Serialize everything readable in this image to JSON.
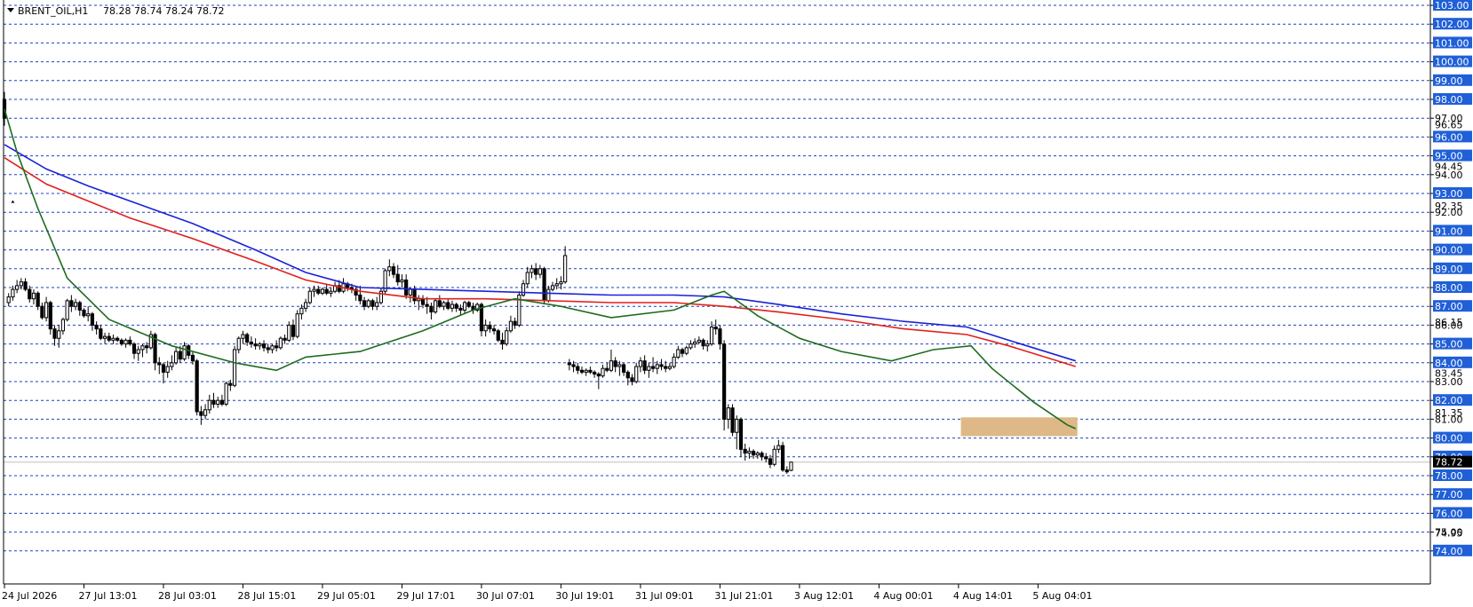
{
  "header": {
    "symbol": "BRENT_OIL,H1",
    "ohlc": "78.28 78.74 78.24 78.72"
  },
  "colors": {
    "grid": "#1f3fbf",
    "price_label_bg": "#1f5fd8",
    "ma_fast": "#1e6b1e",
    "ma_mid": "#e0201a",
    "ma_slow": "#1a22d8",
    "zone": "#deb887",
    "current_price_line": "#c0c0c0"
  },
  "chart_data": {
    "type": "candlestick",
    "ylim": [
      74,
      103
    ],
    "y_ticks": [
      "103.00",
      "102.00",
      "101.00",
      "100.00",
      "99.00",
      "98.00",
      "97.00",
      "96.00",
      "95.00",
      "94.00",
      "93.00",
      "92.00",
      "91.00",
      "90.00",
      "89.00",
      "88.00",
      "87.00",
      "86.00",
      "85.00",
      "84.00",
      "83.00",
      "82.00",
      "81.00",
      "80.00",
      "79.00",
      "78.00",
      "77.00",
      "76.00",
      "75.00",
      "74.00"
    ],
    "y_extra_labels": [
      {
        "value": 96.65,
        "text": "96.65"
      },
      {
        "value": 94.45,
        "text": "94.45"
      },
      {
        "value": 92.35,
        "text": "92.35"
      },
      {
        "value": 86.15,
        "text": "86.15"
      },
      {
        "value": 83.45,
        "text": "83.45"
      },
      {
        "value": 81.35,
        "text": "81.35"
      },
      {
        "value": 74.95,
        "text": "74.95"
      }
    ],
    "current_price": {
      "value": 78.72,
      "text": "78.72"
    },
    "x_labels": [
      "24 Jul 2026",
      "27 Jul 13:01",
      "28 Jul 03:01",
      "28 Jul 15:01",
      "29 Jul 05:01",
      "29 Jul 17:01",
      "30 Jul 07:01",
      "30 Jul 19:01",
      "31 Jul 09:01",
      "31 Jul 21:01",
      "3 Aug 12:01",
      "4 Aug 00:01",
      "4 Aug 14:01",
      "5 Aug 04:01"
    ],
    "x_label_index": [
      0,
      19,
      38,
      57,
      76,
      95,
      114,
      133,
      152,
      171,
      190,
      209,
      228,
      247
    ],
    "zone": {
      "from_index": 229,
      "to_index": 256,
      "low": 80.1,
      "high": 81.1
    },
    "candles": [
      [
        98.0,
        98.4,
        96.6,
        97.0
      ],
      [
        87.2,
        87.7,
        87.0,
        87.5
      ],
      [
        87.5,
        88.1,
        87.3,
        87.9
      ],
      [
        87.9,
        88.4,
        87.7,
        88.1
      ],
      [
        88.1,
        88.5,
        87.9,
        88.3
      ],
      [
        88.3,
        88.5,
        87.8,
        87.9
      ],
      [
        87.9,
        88.1,
        87.2,
        87.4
      ],
      [
        87.4,
        87.9,
        87.1,
        87.7
      ],
      [
        87.7,
        87.8,
        86.8,
        87.0
      ],
      [
        87.0,
        87.2,
        86.3,
        86.4
      ],
      [
        86.4,
        87.5,
        86.2,
        87.2
      ],
      [
        87.2,
        87.3,
        85.5,
        85.8
      ],
      [
        85.8,
        86.0,
        84.9,
        85.3
      ],
      [
        85.3,
        86.0,
        84.8,
        85.7
      ],
      [
        85.7,
        86.4,
        85.5,
        86.3
      ],
      [
        86.3,
        87.4,
        86.2,
        87.3
      ],
      [
        87.3,
        87.6,
        86.7,
        87.0
      ],
      [
        87.0,
        87.4,
        86.8,
        87.2
      ],
      [
        87.2,
        87.3,
        86.5,
        86.8
      ],
      [
        86.8,
        86.9,
        86.4,
        86.5
      ],
      [
        86.5,
        87.0,
        86.2,
        86.6
      ],
      [
        86.6,
        86.7,
        85.7,
        86.0
      ],
      [
        86.0,
        86.2,
        85.5,
        85.8
      ],
      [
        85.8,
        86.0,
        85.2,
        85.3
      ],
      [
        85.3,
        85.6,
        85.0,
        85.4
      ],
      [
        85.4,
        85.6,
        85.1,
        85.2
      ],
      [
        85.2,
        85.5,
        85.0,
        85.3
      ],
      [
        85.3,
        85.4,
        85.1,
        85.2
      ],
      [
        85.2,
        85.3,
        84.9,
        85.0
      ],
      [
        85.0,
        85.3,
        84.8,
        85.2
      ],
      [
        85.2,
        85.4,
        84.9,
        85.0
      ],
      [
        85.0,
        85.1,
        84.2,
        84.5
      ],
      [
        84.5,
        84.9,
        84.1,
        84.7
      ],
      [
        84.7,
        85.0,
        84.3,
        84.9
      ],
      [
        84.9,
        85.1,
        84.5,
        84.8
      ],
      [
        84.8,
        85.7,
        84.7,
        85.5
      ],
      [
        85.5,
        85.6,
        83.6,
        84.0
      ],
      [
        84.0,
        84.3,
        83.4,
        83.9
      ],
      [
        83.9,
        84.0,
        82.9,
        83.5
      ],
      [
        83.5,
        84.1,
        83.2,
        83.8
      ],
      [
        83.8,
        84.4,
        83.6,
        84.0
      ],
      [
        84.0,
        84.8,
        83.9,
        84.6
      ],
      [
        84.6,
        84.9,
        84.0,
        84.2
      ],
      [
        84.2,
        85.1,
        84.1,
        84.9
      ],
      [
        84.9,
        85.0,
        84.2,
        84.4
      ],
      [
        84.4,
        84.6,
        83.9,
        84.1
      ],
      [
        84.1,
        84.2,
        81.2,
        81.4
      ],
      [
        81.4,
        81.7,
        80.7,
        81.2
      ],
      [
        81.2,
        81.8,
        81.0,
        81.5
      ],
      [
        81.5,
        82.3,
        81.3,
        82.0
      ],
      [
        82.0,
        82.4,
        81.6,
        81.8
      ],
      [
        81.8,
        82.2,
        81.6,
        82.0
      ],
      [
        82.0,
        82.3,
        81.7,
        81.8
      ],
      [
        81.8,
        83.0,
        81.7,
        82.9
      ],
      [
        82.9,
        83.1,
        82.5,
        82.8
      ],
      [
        82.8,
        84.9,
        82.7,
        84.7
      ],
      [
        84.7,
        85.4,
        84.5,
        85.3
      ],
      [
        85.3,
        85.7,
        85.0,
        85.5
      ],
      [
        85.5,
        85.6,
        84.9,
        85.1
      ],
      [
        85.1,
        85.4,
        84.8,
        85.0
      ],
      [
        85.0,
        85.3,
        84.7,
        84.9
      ],
      [
        84.9,
        85.1,
        84.7,
        85.0
      ],
      [
        85.0,
        85.2,
        84.6,
        84.8
      ],
      [
        84.8,
        85.0,
        84.5,
        84.7
      ],
      [
        84.7,
        85.0,
        84.5,
        84.9
      ],
      [
        84.9,
        85.2,
        84.6,
        84.8
      ],
      [
        84.8,
        85.4,
        84.7,
        85.3
      ],
      [
        85.3,
        85.5,
        85.0,
        85.2
      ],
      [
        85.2,
        86.2,
        85.1,
        86.0
      ],
      [
        86.0,
        86.3,
        85.2,
        85.4
      ],
      [
        85.4,
        86.8,
        85.3,
        86.6
      ],
      [
        86.6,
        87.1,
        86.3,
        86.9
      ],
      [
        86.9,
        87.4,
        86.7,
        87.2
      ],
      [
        87.2,
        88.0,
        87.1,
        87.8
      ],
      [
        87.8,
        88.1,
        87.5,
        87.9
      ],
      [
        87.9,
        88.1,
        87.6,
        87.7
      ],
      [
        87.7,
        88.0,
        87.6,
        87.9
      ],
      [
        87.9,
        88.2,
        87.6,
        87.7
      ],
      [
        87.7,
        88.0,
        87.5,
        87.8
      ],
      [
        87.8,
        88.3,
        87.7,
        88.1
      ],
      [
        88.1,
        88.4,
        87.7,
        87.8
      ],
      [
        87.8,
        88.5,
        87.7,
        88.2
      ],
      [
        88.2,
        88.3,
        87.8,
        88.0
      ],
      [
        88.0,
        88.2,
        87.7,
        87.9
      ],
      [
        87.9,
        88.0,
        87.3,
        87.6
      ],
      [
        87.6,
        88.1,
        87.1,
        87.3
      ],
      [
        87.3,
        87.5,
        86.8,
        87.0
      ],
      [
        87.0,
        87.4,
        86.9,
        87.3
      ],
      [
        87.3,
        87.4,
        86.8,
        87.0
      ],
      [
        87.0,
        87.5,
        86.8,
        87.2
      ],
      [
        87.2,
        88.0,
        87.1,
        87.8
      ],
      [
        87.8,
        89.0,
        87.6,
        88.9
      ],
      [
        88.9,
        89.5,
        88.6,
        89.1
      ],
      [
        89.1,
        89.3,
        88.5,
        88.7
      ],
      [
        88.7,
        89.2,
        88.1,
        88.3
      ],
      [
        88.3,
        88.7,
        88.0,
        88.4
      ],
      [
        88.4,
        88.7,
        87.4,
        87.6
      ],
      [
        87.6,
        88.0,
        87.2,
        87.9
      ],
      [
        87.9,
        88.1,
        87.1,
        87.3
      ],
      [
        87.3,
        87.6,
        86.8,
        87.4
      ],
      [
        87.4,
        87.6,
        86.9,
        87.1
      ],
      [
        87.1,
        87.5,
        86.6,
        87.0
      ],
      [
        87.0,
        87.2,
        86.3,
        86.7
      ],
      [
        86.7,
        87.4,
        86.6,
        87.3
      ],
      [
        87.3,
        87.6,
        86.9,
        87.0
      ],
      [
        87.0,
        87.3,
        86.8,
        87.2
      ],
      [
        87.2,
        87.4,
        86.8,
        86.9
      ],
      [
        86.9,
        87.3,
        86.7,
        87.1
      ],
      [
        87.1,
        87.2,
        86.7,
        86.9
      ],
      [
        86.9,
        87.1,
        86.5,
        86.8
      ],
      [
        86.8,
        87.3,
        86.6,
        87.2
      ],
      [
        87.2,
        87.3,
        86.9,
        87.0
      ],
      [
        87.0,
        87.2,
        86.6,
        86.8
      ],
      [
        86.8,
        87.2,
        86.7,
        87.1
      ],
      [
        87.1,
        87.2,
        85.4,
        85.7
      ],
      [
        85.7,
        86.3,
        85.4,
        86.0
      ],
      [
        86.0,
        86.2,
        85.6,
        85.8
      ],
      [
        85.8,
        86.0,
        85.5,
        85.7
      ],
      [
        85.7,
        85.8,
        85.1,
        85.2
      ],
      [
        85.2,
        85.6,
        84.7,
        85.0
      ],
      [
        85.0,
        85.9,
        84.9,
        85.7
      ],
      [
        85.7,
        86.5,
        85.6,
        86.2
      ],
      [
        86.2,
        86.4,
        85.8,
        86.0
      ],
      [
        86.0,
        87.8,
        85.9,
        87.6
      ],
      [
        87.6,
        88.4,
        87.5,
        88.2
      ],
      [
        88.2,
        89.1,
        88.0,
        88.8
      ],
      [
        88.8,
        89.2,
        88.5,
        89.0
      ],
      [
        89.0,
        89.3,
        88.4,
        88.7
      ],
      [
        88.7,
        89.2,
        88.5,
        89.0
      ],
      [
        89.0,
        89.1,
        87.1,
        87.3
      ],
      [
        87.3,
        88.1,
        87.2,
        87.9
      ],
      [
        87.9,
        88.3,
        87.8,
        88.1
      ],
      [
        88.1,
        88.5,
        87.9,
        88.2
      ],
      [
        88.2,
        88.6,
        87.9,
        88.3
      ],
      [
        88.3,
        90.2,
        88.2,
        89.7
      ],
      [
        84.0,
        84.2,
        83.6,
        83.9
      ],
      [
        83.9,
        84.1,
        83.5,
        83.8
      ],
      [
        83.8,
        84.0,
        83.4,
        83.6
      ],
      [
        83.6,
        83.8,
        83.4,
        83.5
      ],
      [
        83.5,
        83.7,
        83.3,
        83.6
      ],
      [
        83.6,
        83.8,
        83.4,
        83.5
      ],
      [
        83.5,
        83.6,
        83.2,
        83.4
      ],
      [
        83.4,
        83.5,
        82.6,
        83.3
      ],
      [
        83.3,
        83.9,
        83.2,
        83.7
      ],
      [
        83.7,
        84.0,
        83.5,
        83.6
      ],
      [
        83.6,
        84.7,
        83.5,
        84.1
      ],
      [
        84.1,
        84.3,
        83.5,
        83.8
      ],
      [
        83.8,
        84.1,
        83.3,
        83.9
      ],
      [
        83.9,
        84.0,
        83.3,
        83.5
      ],
      [
        83.5,
        83.6,
        82.8,
        83.2
      ],
      [
        83.2,
        83.4,
        82.8,
        83.0
      ],
      [
        83.0,
        84.0,
        82.9,
        83.8
      ],
      [
        83.8,
        84.3,
        83.5,
        84.1
      ],
      [
        84.1,
        84.4,
        83.4,
        83.6
      ],
      [
        83.6,
        84.0,
        83.2,
        83.8
      ],
      [
        83.8,
        84.3,
        83.5,
        83.7
      ],
      [
        83.7,
        84.1,
        83.4,
        83.9
      ],
      [
        83.9,
        84.2,
        83.6,
        83.8
      ],
      [
        83.8,
        84.1,
        83.5,
        83.7
      ],
      [
        83.7,
        84.0,
        83.6,
        83.8
      ],
      [
        83.8,
        84.5,
        83.7,
        84.3
      ],
      [
        84.3,
        84.9,
        84.2,
        84.7
      ],
      [
        84.7,
        84.8,
        84.3,
        84.5
      ],
      [
        84.5,
        84.9,
        84.4,
        84.8
      ],
      [
        84.8,
        85.2,
        84.7,
        85.0
      ],
      [
        85.0,
        85.3,
        84.8,
        85.1
      ],
      [
        85.1,
        85.4,
        85.0,
        85.2
      ],
      [
        85.2,
        85.3,
        84.7,
        84.9
      ],
      [
        84.9,
        85.2,
        84.6,
        85.0
      ],
      [
        85.0,
        86.2,
        84.9,
        85.9
      ],
      [
        85.9,
        86.3,
        85.5,
        85.8
      ],
      [
        85.8,
        86.0,
        84.7,
        85.0
      ],
      [
        85.0,
        85.2,
        80.4,
        81.0
      ],
      [
        81.0,
        81.8,
        80.5,
        81.6
      ],
      [
        81.6,
        81.8,
        80.1,
        80.3
      ],
      [
        80.3,
        81.2,
        79.4,
        81.0
      ],
      [
        81.0,
        81.1,
        79.0,
        79.4
      ],
      [
        79.4,
        79.7,
        78.8,
        79.2
      ],
      [
        79.2,
        79.5,
        78.9,
        79.3
      ],
      [
        79.3,
        79.4,
        78.9,
        79.1
      ],
      [
        79.1,
        79.3,
        78.9,
        79.2
      ],
      [
        79.2,
        79.3,
        78.8,
        79.0
      ],
      [
        79.0,
        79.2,
        78.7,
        78.9
      ],
      [
        78.9,
        79.1,
        78.4,
        78.6
      ],
      [
        78.6,
        79.6,
        78.5,
        79.4
      ],
      [
        79.4,
        79.9,
        79.2,
        79.6
      ],
      [
        79.6,
        79.8,
        78.2,
        78.3
      ],
      [
        78.3,
        78.5,
        78.1,
        78.2
      ],
      [
        78.28,
        78.74,
        78.24,
        78.72
      ]
    ],
    "ma_fast": [
      [
        0,
        97.5
      ],
      [
        3,
        95.2
      ],
      [
        8,
        92.2
      ],
      [
        15,
        88.5
      ],
      [
        25,
        86.3
      ],
      [
        40,
        84.9
      ],
      [
        55,
        84.0
      ],
      [
        65,
        83.6
      ],
      [
        72,
        84.3
      ],
      [
        85,
        84.6
      ],
      [
        100,
        85.7
      ],
      [
        112,
        86.8
      ],
      [
        122,
        87.4
      ],
      [
        133,
        87.0
      ],
      [
        145,
        86.4
      ],
      [
        160,
        86.8
      ],
      [
        169,
        87.6
      ],
      [
        172,
        87.8
      ],
      [
        180,
        86.5
      ],
      [
        190,
        85.3
      ],
      [
        200,
        84.6
      ],
      [
        212,
        84.1
      ],
      [
        222,
        84.7
      ],
      [
        231,
        84.9
      ],
      [
        236,
        83.7
      ],
      [
        246,
        81.9
      ],
      [
        254,
        80.7
      ],
      [
        256,
        80.5
      ]
    ],
    "ma_mid": [
      [
        0,
        94.9
      ],
      [
        10,
        93.5
      ],
      [
        20,
        92.6
      ],
      [
        30,
        91.7
      ],
      [
        45,
        90.6
      ],
      [
        60,
        89.4
      ],
      [
        72,
        88.4
      ],
      [
        85,
        87.8
      ],
      [
        100,
        87.4
      ],
      [
        115,
        87.4
      ],
      [
        130,
        87.3
      ],
      [
        145,
        87.2
      ],
      [
        160,
        87.2
      ],
      [
        172,
        87.0
      ],
      [
        185,
        86.7
      ],
      [
        200,
        86.3
      ],
      [
        215,
        85.8
      ],
      [
        230,
        85.5
      ],
      [
        240,
        84.9
      ],
      [
        256,
        83.8
      ]
    ],
    "ma_slow": [
      [
        0,
        95.6
      ],
      [
        10,
        94.3
      ],
      [
        20,
        93.4
      ],
      [
        30,
        92.6
      ],
      [
        45,
        91.4
      ],
      [
        60,
        90.0
      ],
      [
        72,
        88.8
      ],
      [
        85,
        88.0
      ],
      [
        100,
        87.9
      ],
      [
        115,
        87.8
      ],
      [
        130,
        87.7
      ],
      [
        145,
        87.6
      ],
      [
        160,
        87.6
      ],
      [
        172,
        87.5
      ],
      [
        185,
        87.1
      ],
      [
        200,
        86.6
      ],
      [
        215,
        86.2
      ],
      [
        230,
        85.9
      ],
      [
        240,
        85.2
      ],
      [
        256,
        84.1
      ]
    ],
    "ma_start_marker": {
      "index": 2,
      "value": 92.5
    }
  }
}
